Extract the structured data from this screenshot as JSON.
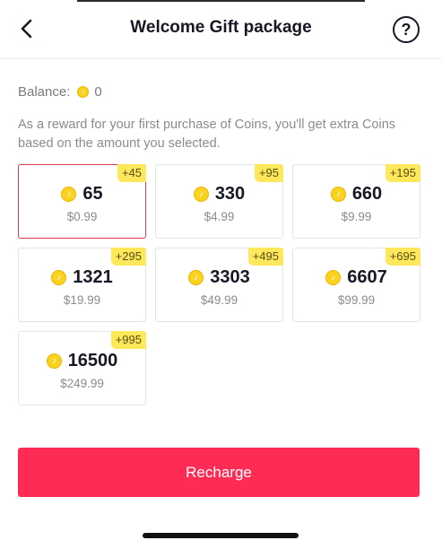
{
  "header": {
    "title": "Welcome Gift package",
    "back_icon": "chevron-left-icon",
    "help_icon": "question-circle-icon",
    "help_glyph": "?"
  },
  "balance": {
    "label": "Balance:",
    "value": "0"
  },
  "info_text": "As a reward for your first purchase of Coins, you'll get extra Coins based on the amount you selected.",
  "coin_icon_glyph": "♪",
  "packages": [
    {
      "coins": "65",
      "bonus": "+45",
      "price": "$0.99",
      "selected": true
    },
    {
      "coins": "330",
      "bonus": "+95",
      "price": "$4.99",
      "selected": false
    },
    {
      "coins": "660",
      "bonus": "+195",
      "price": "$9.99",
      "selected": false
    },
    {
      "coins": "1321",
      "bonus": "+295",
      "price": "$19.99",
      "selected": false
    },
    {
      "coins": "3303",
      "bonus": "+495",
      "price": "$49.99",
      "selected": false
    },
    {
      "coins": "6607",
      "bonus": "+695",
      "price": "$99.99",
      "selected": false
    },
    {
      "coins": "16500",
      "bonus": "+995",
      "price": "$249.99",
      "selected": false
    }
  ],
  "recharge_label": "Recharge",
  "colors": {
    "accent": "#fe2c55",
    "selected_border": "#d93a50",
    "bonus_badge": "#fce85a",
    "coin": "#fbd21e"
  }
}
